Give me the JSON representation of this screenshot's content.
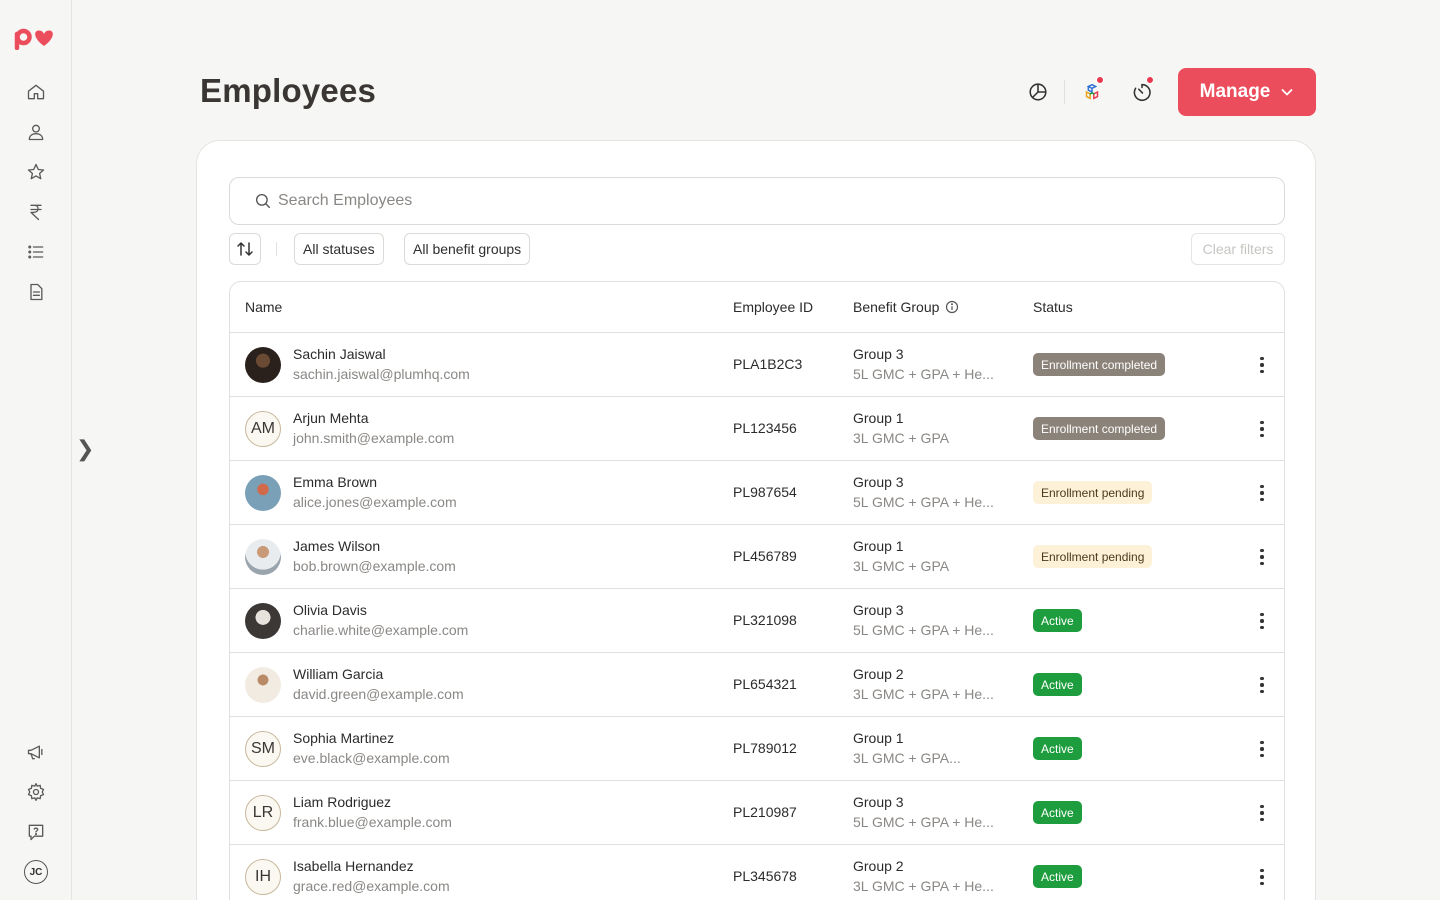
{
  "colors": {
    "accent": "#ec4d5c",
    "active": "#1e9d3e",
    "completed": "#8b8279",
    "pending": "#fdf1d8"
  },
  "sidebar": {
    "logo": "pv",
    "items": [
      {
        "icon": "home-icon"
      },
      {
        "icon": "user-icon"
      },
      {
        "icon": "star-icon"
      },
      {
        "icon": "rupee-icon"
      },
      {
        "icon": "list-icon"
      },
      {
        "icon": "document-icon"
      }
    ],
    "bottom_items": [
      {
        "icon": "megaphone-icon"
      },
      {
        "icon": "gear-icon"
      },
      {
        "icon": "help-icon"
      }
    ],
    "user_initials": "JC",
    "expand_glyph": "❯"
  },
  "header": {
    "title": "Employees",
    "manage_label": "Manage"
  },
  "search": {
    "placeholder": "Search Employees",
    "value": ""
  },
  "filters": {
    "status_label": "All statuses",
    "benefit_group_label": "All benefit groups",
    "clear_label": "Clear filters"
  },
  "table": {
    "columns": {
      "name": "Name",
      "employee_id": "Employee ID",
      "benefit_group": "Benefit Group",
      "status": "Status"
    },
    "rows": [
      {
        "name": "Sachin Jaiswal",
        "email": "sachin.jaiswal@plumhq.com",
        "id": "PLA1B2C3",
        "group": "Group 3",
        "plan": "5L GMC + GPA + He...",
        "status": "Enrollment completed",
        "status_type": "completed",
        "initials": "",
        "photo": "dark"
      },
      {
        "name": "Arjun Mehta",
        "email": "john.smith@example.com",
        "id": "PL123456",
        "group": "Group 1",
        "plan": "3L GMC + GPA",
        "status": "Enrollment completed",
        "status_type": "completed",
        "initials": "AM",
        "photo": ""
      },
      {
        "name": "Emma Brown",
        "email": "alice.jones@example.com",
        "id": "PL987654",
        "group": "Group 3",
        "plan": "5L GMC + GPA + He...",
        "status": "Enrollment pending",
        "status_type": "pending",
        "initials": "",
        "photo": "blue"
      },
      {
        "name": "James Wilson",
        "email": "bob.brown@example.com",
        "id": "PL456789",
        "group": "Group 1",
        "plan": "3L GMC + GPA",
        "status": "Enrollment pending",
        "status_type": "pending",
        "initials": "",
        "photo": "light"
      },
      {
        "name": "Olivia Davis",
        "email": "charlie.white@example.com",
        "id": "PL321098",
        "group": "Group 3",
        "plan": "5L GMC + GPA + He...",
        "status": "Active",
        "status_type": "active",
        "initials": "",
        "photo": "darkgrey"
      },
      {
        "name": "William Garcia",
        "email": "david.green@example.com",
        "id": "PL654321",
        "group": "Group 2",
        "plan": "3L GMC + GPA + He...",
        "status": "Active",
        "status_type": "active",
        "initials": "",
        "photo": "beige"
      },
      {
        "name": "Sophia Martinez",
        "email": "eve.black@example.com",
        "id": "PL789012",
        "group": "Group 1",
        "plan": "3L GMC + GPA...",
        "status": "Active",
        "status_type": "active",
        "initials": "SM",
        "photo": ""
      },
      {
        "name": "Liam Rodriguez",
        "email": "frank.blue@example.com",
        "id": "PL210987",
        "group": "Group 3",
        "plan": "5L GMC + GPA + He...",
        "status": "Active",
        "status_type": "active",
        "initials": "LR",
        "photo": ""
      },
      {
        "name": "Isabella Hernandez",
        "email": "grace.red@example.com",
        "id": "PL345678",
        "group": "Group 2",
        "plan": "3L GMC + GPA + He...",
        "status": "Active",
        "status_type": "active",
        "initials": "IH",
        "photo": ""
      }
    ]
  }
}
